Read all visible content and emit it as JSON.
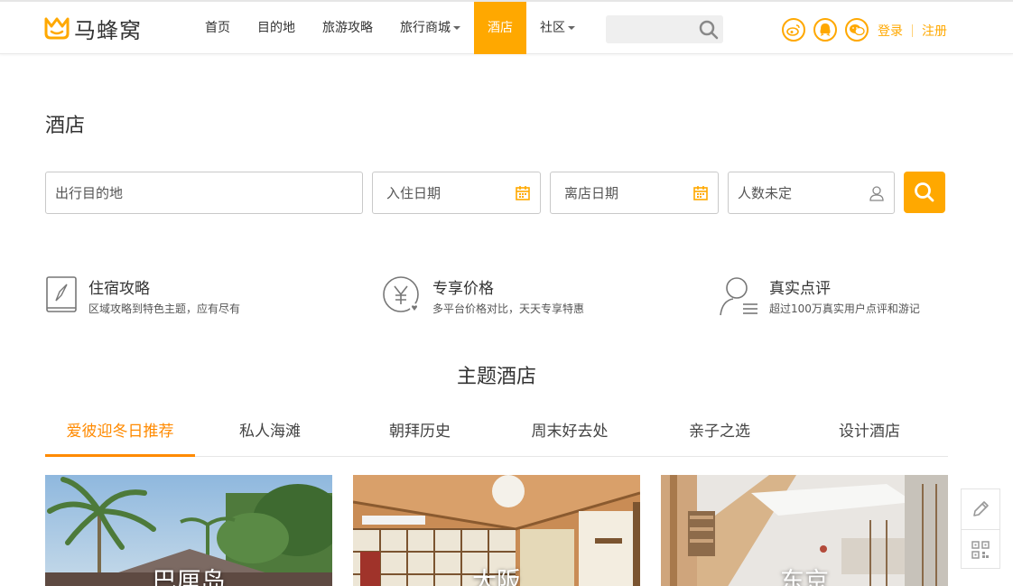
{
  "header": {
    "logo_text": "马蜂窝",
    "nav": [
      {
        "label": "首页",
        "dropdown": false,
        "active": false
      },
      {
        "label": "目的地",
        "dropdown": false,
        "active": false
      },
      {
        "label": "旅游攻略",
        "dropdown": false,
        "active": false
      },
      {
        "label": "旅行商城",
        "dropdown": true,
        "active": false
      },
      {
        "label": "酒店",
        "dropdown": false,
        "active": true
      },
      {
        "label": "社区",
        "dropdown": true,
        "active": false
      }
    ],
    "search_placeholder": "",
    "social_icons": [
      "weibo-icon",
      "qq-icon",
      "wechat-icon"
    ],
    "login_label": "登录",
    "register_label": "注册"
  },
  "page_title": "酒店",
  "search_form": {
    "destination_placeholder": "出行目的地",
    "checkin_placeholder": "入住日期",
    "checkout_placeholder": "离店日期",
    "guests_placeholder": "人数未定"
  },
  "features": [
    {
      "icon": "guidebook-icon",
      "title": "住宿攻略",
      "desc": "区域攻略到特色主题，应有尽有"
    },
    {
      "icon": "price-icon",
      "title": "专享价格",
      "desc": "多平台价格对比，天天专享特惠"
    },
    {
      "icon": "review-icon",
      "title": "真实点评",
      "desc": "超过100万真实用户点评和游记"
    }
  ],
  "section_title": "主题酒店",
  "tabs": [
    {
      "label": "爱彼迎冬日推荐",
      "active": true
    },
    {
      "label": "私人海滩",
      "active": false
    },
    {
      "label": "朝拜历史",
      "active": false
    },
    {
      "label": "周末好去处",
      "active": false
    },
    {
      "label": "亲子之选",
      "active": false
    },
    {
      "label": "设计酒店",
      "active": false
    }
  ],
  "cards": [
    {
      "name": "巴厘岛"
    },
    {
      "name": "大阪"
    },
    {
      "name": "东京"
    }
  ],
  "float_tools": [
    "edit-icon",
    "qrcode-icon"
  ],
  "colors": {
    "accent": "#ffa800",
    "tab_active": "#ff8a00"
  }
}
